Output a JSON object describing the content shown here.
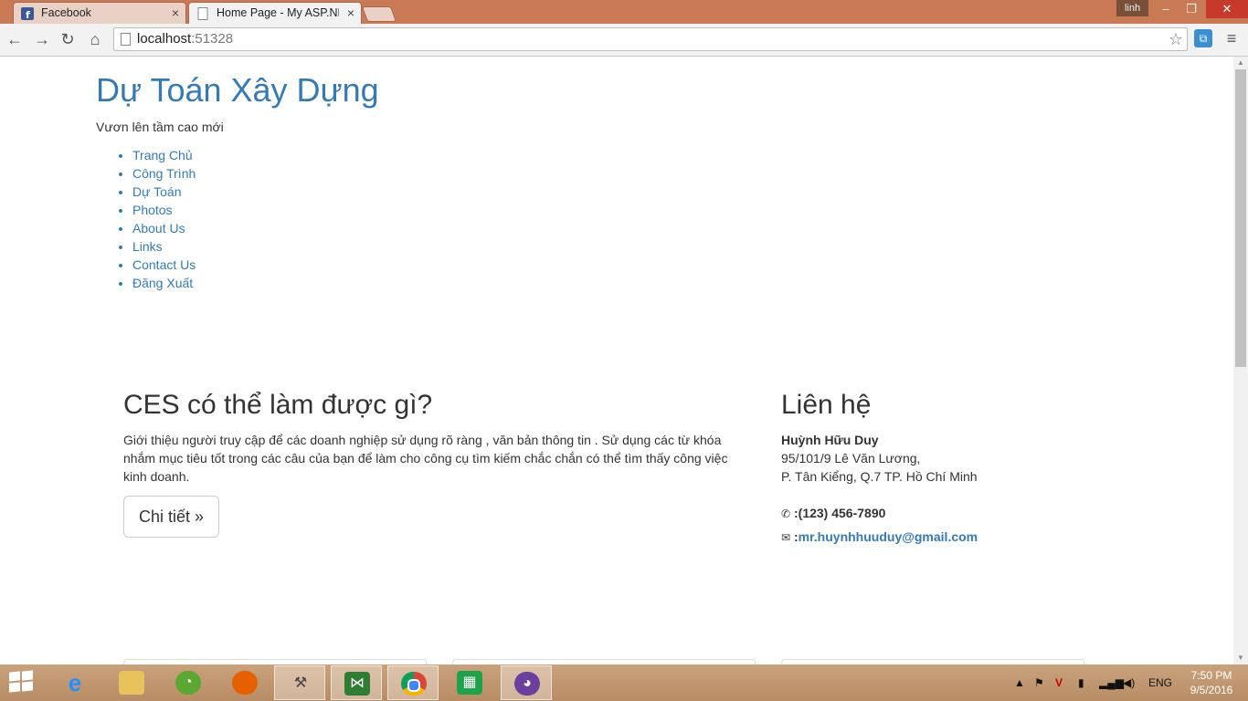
{
  "browser": {
    "tabs": [
      {
        "label": "Facebook",
        "active": false
      },
      {
        "label": "Home Page - My ASP.NET",
        "active": true
      }
    ],
    "user_badge": "linh",
    "url_host": "localhost",
    "url_port": ":51328"
  },
  "site": {
    "title": "Dự Toán Xây Dựng",
    "tagline": "Vươn lên tầm cao mới",
    "nav": [
      "Trang Chủ",
      "Công Trình",
      "Dự Toán",
      "Photos",
      "About Us",
      "Links",
      "Contact Us",
      "Đăng Xuất"
    ]
  },
  "main": {
    "heading": "CES có thể làm được gì?",
    "paragraph": "Giới thiệu người truy cập để các doanh nghiệp sử dụng rõ ràng , văn bản thông tin . Sử dụng các từ khóa nhắm mục tiêu tốt trong các câu của bạn để làm cho công cụ tìm kiếm chắc chắn có thể tìm thấy công việc kinh doanh.",
    "detail_button": "Chi tiết »"
  },
  "contact": {
    "heading": "Liên hệ",
    "name": "Huỳnh Hữu Duy",
    "address_line1": "95/101/9 Lê Văn Lương,",
    "address_line2": "P. Tân Kiểng, Q.7 TP. Hồ Chí Minh",
    "phone": ":(123) 456-7890",
    "email_prefix": ":",
    "email": "mr.huynhhuuduy@gmail.com"
  },
  "taskbar": {
    "language": "ENG",
    "time": "7:50 PM",
    "date": "9/5/2016",
    "apps": [
      "internet-explorer",
      "file-explorer",
      "app-green",
      "firefox",
      "tools",
      "visual-studio",
      "chrome",
      "store",
      "github"
    ]
  }
}
